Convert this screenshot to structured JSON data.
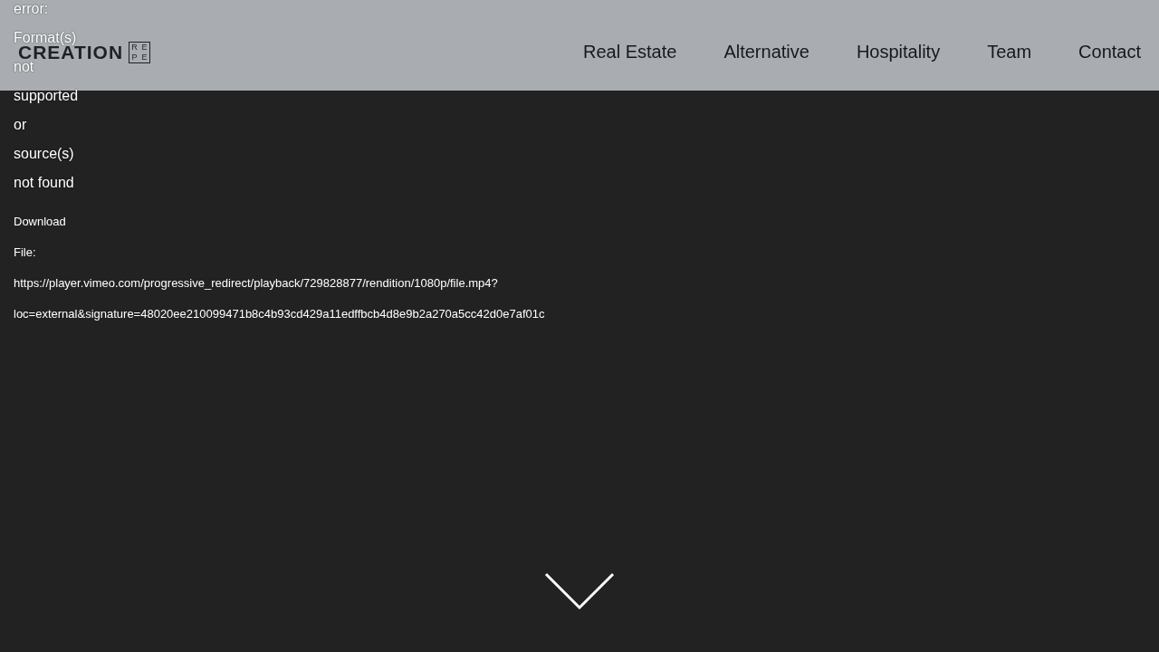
{
  "error_message": [
    "error:",
    "Format(s)",
    "not",
    "supported",
    "or",
    "source(s)",
    "not found"
  ],
  "download_lines": [
    "Download",
    "File:",
    "https://player.vimeo.com/progressive_redirect/playback/729828877/rendition/1080p/file.mp4?",
    "loc=external&signature=48020ee210099471b8c4b93cd429a11edffbcb4d8e9b2a270a5cc42d0e7af01c"
  ],
  "header": {
    "logo": {
      "name": "CREATION",
      "mark_letters": [
        "R",
        "E",
        "P",
        "E"
      ]
    },
    "nav": [
      "Real Estate",
      "Alternative",
      "Hospitality",
      "Team",
      "Contact"
    ]
  }
}
